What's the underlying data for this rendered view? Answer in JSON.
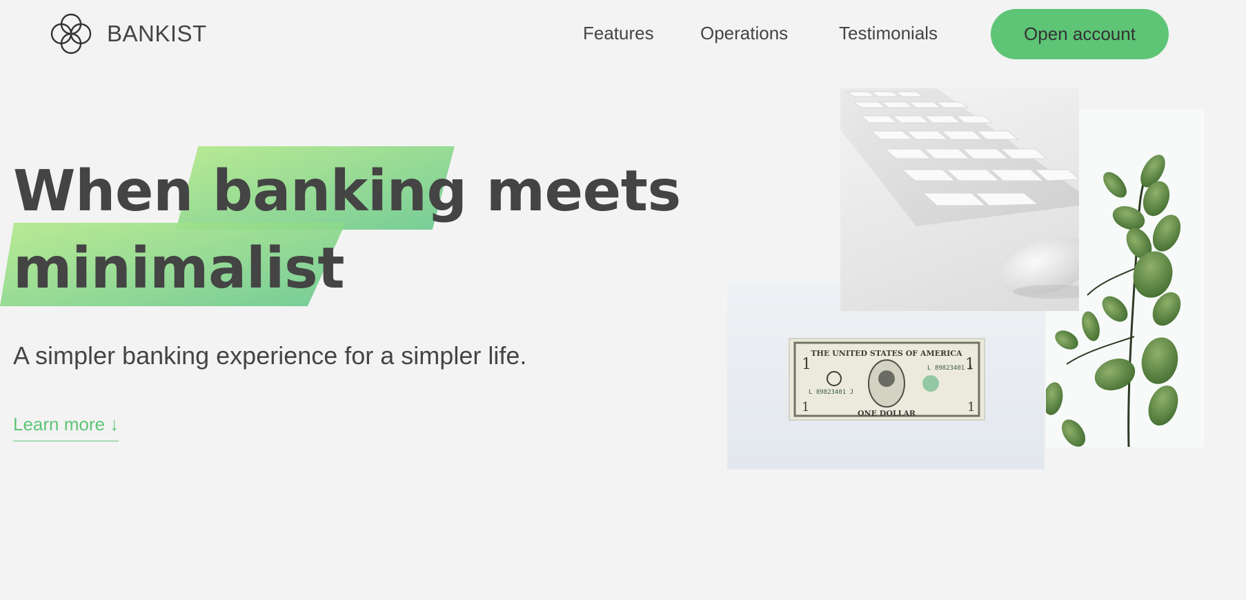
{
  "nav": {
    "brand": "BANKIST",
    "links": [
      "Features",
      "Operations",
      "Testimonials"
    ],
    "cta": "Open account"
  },
  "hero": {
    "headline_line1_a": "When",
    "headline_line1_b": "banking",
    "headline_line1_c": "meets",
    "headline_line2": "minimalist",
    "subtitle": "A simpler banking experience for a simpler life.",
    "learn_more": "Learn more ↓"
  },
  "images": {
    "dollar_bill": {
      "top_text": "THE UNITED STATES OF AMERICA",
      "serial": "L 89823401 J",
      "denomination": "ONE DOLLAR",
      "corner_value": "1"
    }
  },
  "colors": {
    "accent": "#5ec576",
    "text": "#444444",
    "background": "#f3f3f3",
    "highlight_start": "#b3e989",
    "highlight_end": "#68c88d"
  },
  "icons": {
    "logo": "four-circle-flower-logo"
  }
}
